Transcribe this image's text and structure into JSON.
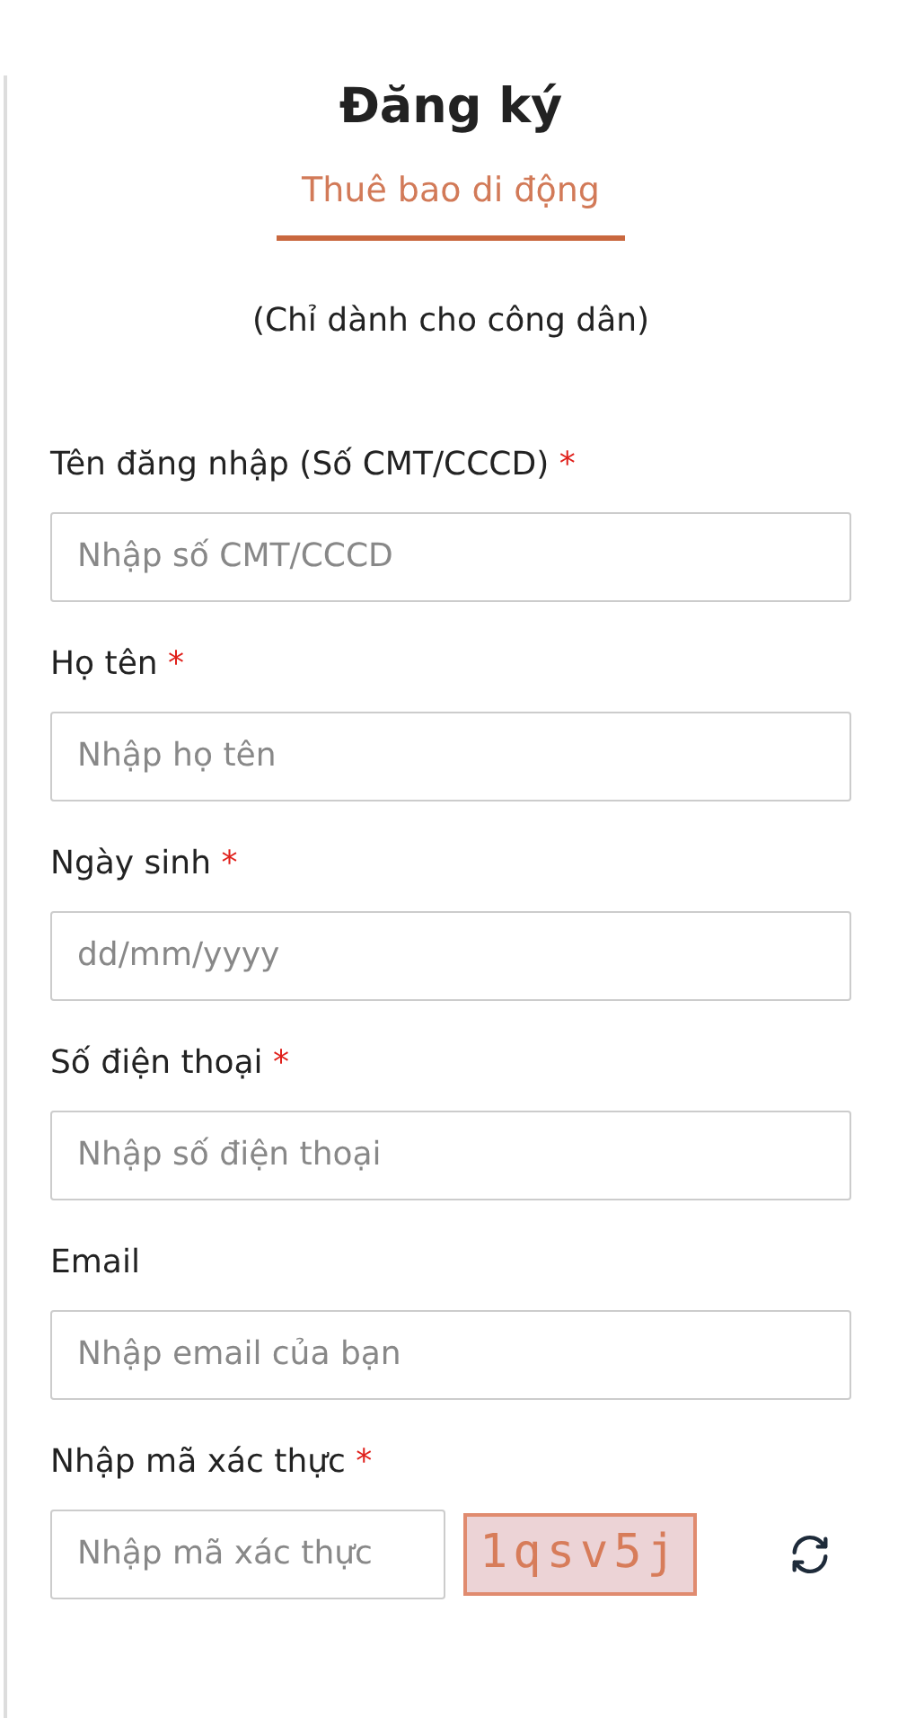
{
  "title": "Đăng ký",
  "tabs": [
    {
      "label": "Thuê bao di động",
      "selected": true
    }
  ],
  "note": "(Chỉ dành cho công dân)",
  "fields": [
    {
      "label": "Tên đăng nhập (Số CMT/CCCD)",
      "required_mark": "*",
      "placeholder": "Nhập số CMT/CCCD"
    },
    {
      "label": "Họ tên",
      "required_mark": "*",
      "placeholder": "Nhập họ tên"
    },
    {
      "label": "Ngày sinh",
      "required_mark": "*",
      "placeholder": "dd/mm/yyyy"
    },
    {
      "label": "Số điện thoại",
      "required_mark": "*",
      "placeholder": "Nhập số điện thoại"
    },
    {
      "label": "Email",
      "placeholder": "Nhập email của bạn"
    }
  ],
  "captcha": {
    "label": "Nhập mã xác thực",
    "required_mark": "*",
    "placeholder": "Nhập mã xác thực",
    "code": "1qsv5j"
  }
}
